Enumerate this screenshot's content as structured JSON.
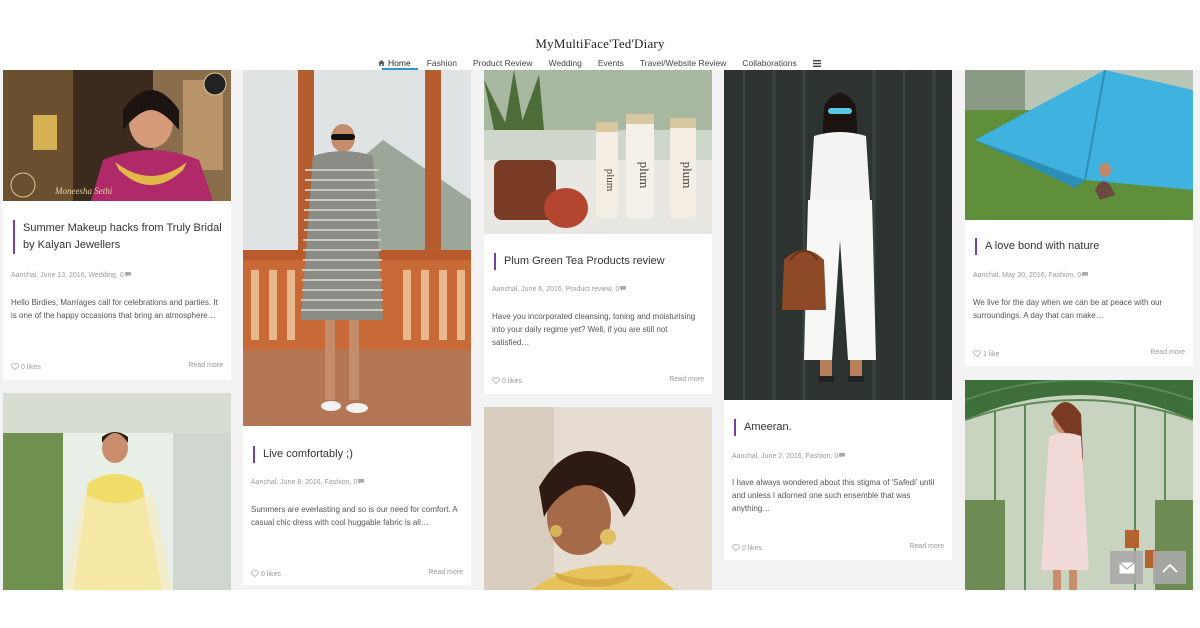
{
  "site": {
    "title": "MyMultiFace'Ted'Diary"
  },
  "nav": {
    "items": [
      "Home",
      "Fashion",
      "Product Review",
      "Wedding",
      "Events",
      "Travel/Website Review",
      "Collaborations"
    ],
    "active": "Home",
    "menu_icon": "hamburger-menu-icon",
    "accent_color": "#2f95ce"
  },
  "posts": [
    {
      "title": "Summer Makeup hacks from Truly Bridal by Kalyan Jewellers",
      "meta": "Aanchal, June 13, 2016, Wedding, 0",
      "excerpt": "Hello Birdies, Marriages call for celebrations and parties. It is one of the happy occasions that bring an atmosphere…",
      "likes": "0 likes",
      "read_more": "Read more"
    },
    {
      "title": "Live comfortably ;)",
      "meta": "Aanchal, June 8, 2016, Fashion, 0",
      "excerpt": "Summers are everlasting and so is our need for comfort. A casual chic dress with cool huggable fabric is all…",
      "likes": "0 likes",
      "read_more": "Read more"
    },
    {
      "title": "Plum Green Tea Products review",
      "meta": "Aanchal, June 6, 2016, Product review, 0",
      "excerpt": "Have you incorporated cleansing, toning and moisturising into your daily regime yet? Well, if you are still not satisfied…",
      "likes": "0 likes",
      "read_more": "Read more"
    },
    {
      "title": "Ameeran.",
      "meta": "Aanchal, June 2, 2016, Fashion, 0",
      "excerpt": "I have always wondered about this stigma of 'Safedi' until and unless I adorned one such ensemble that was anything…",
      "likes": "0 likes",
      "read_more": "Read more"
    },
    {
      "title": "A love bond with nature",
      "meta": "Aanchal, May 30, 2016, Fashion, 0",
      "excerpt": "We live for the day when we can be at peace with our surroundings. A day that can make…",
      "likes": "1 like",
      "read_more": "Read more"
    }
  ],
  "photo_caption": "Moneesha Sethi",
  "colors": {
    "accent_purple": "#7b3fa0",
    "page_bg": "#f3f3f3",
    "fab_bg": "#aaaaaa"
  },
  "floating": {
    "mail_icon": "envelope-icon",
    "top_icon": "chevron-up-icon"
  }
}
